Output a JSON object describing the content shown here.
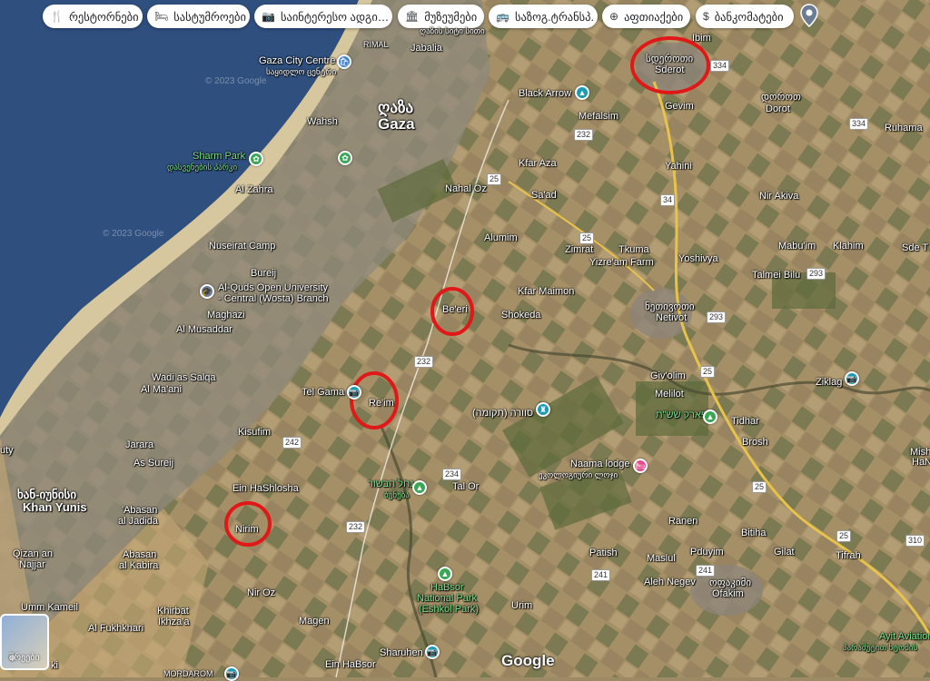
{
  "chips": [
    {
      "label": "რესტორნები",
      "icon": "fork-knife-icon",
      "glyph": "🍴"
    },
    {
      "label": "სასტუმროები",
      "icon": "bed-icon",
      "glyph": "🛏"
    },
    {
      "label": "საინტერესო ადგი…",
      "icon": "camera-icon",
      "glyph": "📷"
    },
    {
      "label": "მუზეუმები",
      "icon": "museum-icon",
      "glyph": "🏛"
    },
    {
      "label": "საზოგ.ტრანსპ.",
      "icon": "bus-icon",
      "glyph": "🚌"
    },
    {
      "label": "აფთიაქები",
      "icon": "pharmacy-icon",
      "glyph": "⊕"
    },
    {
      "label": "ბანკომატები",
      "icon": "atm-icon",
      "glyph": "$"
    }
  ],
  "labels": {
    "gaza_geo": "ღაზა",
    "gaza": "Gaza",
    "rimal": "RIMAL",
    "jabalia": "Jabalia",
    "gaza_city_centre": "Gaza City Centre",
    "gaza_city_centre_geo": "საყიდლო ცენტრი",
    "wahsh": "Wahsh",
    "sharm_park": "Sharm Park",
    "sharm_park_geo": "დასვენების პარკი",
    "al_zahra": "Al Zahra",
    "nuseirat": "Nuseirat Camp",
    "bureij": "Bureij",
    "alquds1": "Al-Quds Open University",
    "alquds2": "- Central (Wosta) Branch",
    "maghazi": "Maghazi",
    "al_musaddar": "Al Musaddar",
    "wadi": "Wadi as Salqa",
    "al_maani": "Al Ma'ani",
    "kisufim": "Kisufim",
    "jarara": "Jarara",
    "as_sureij": "As Sureij",
    "khan_yunis_geo": "ხან-იუნისი",
    "khan_yunis": "Khan Yunis",
    "abasan_jadida1": "'Abasan",
    "abasan_jadida2": "al Jadida",
    "qizan1": "Qizan an",
    "qizan2": "Najjar",
    "abasan_kabira1": "Abasan",
    "abasan_kabira2": "al Kabira",
    "umm_kameil": "Umm Kameil",
    "khirbat1": "Khirbat",
    "khirbat2": "Ikhza'a",
    "al_fukhkhari": "Al Fukhkhari",
    "mordarom": "MORDAROM",
    "ein_hashlosha": "Ein HaShlosha",
    "nirim": "Nirim",
    "nir_oz": "Nir Oz",
    "magen": "Magen",
    "sharuhen": "Sharuhen",
    "ein_habsor": "Ein HaBsor",
    "tel_gama": "Tel Gama",
    "reim": "Re'im",
    "beeri": "Be'eri",
    "shokeda": "Shokeda",
    "kfar_maimon": "Kfar Maimon",
    "alumim": "Alumim",
    "nahal_oz": "Nahal Oz",
    "kfar_aza": "Kfar Aza",
    "saad": "Sa'ad",
    "black_arrow": "Black Arrow",
    "mefalsim": "Mefalsim",
    "ibim": "Ibim",
    "sderot_geo": "სდეროთი",
    "sderot": "Sderot",
    "gevim": "Gevim",
    "dorot_geo": "დოროთ",
    "dorot": "Dorot",
    "ruhama": "Ruhama",
    "yahini": "Yahini",
    "nir_akiva": "Nir Akiva",
    "zimrat": "Zimrat",
    "tkuma": "Tkuma",
    "yizre_am": "Yizre'am Farm",
    "yoshivya": "Yoshivya",
    "mabuim": "Mabu'im",
    "klahim": "Klahim",
    "sde_t": "Sde T",
    "talmei_bilu": "Talmei Bilu",
    "netivot_geo": "ნეთივოთი",
    "netivot": "Netivot",
    "givolim": "Giv'olim",
    "melilot": "Melilot",
    "ziklag": "Ziklag",
    "park_sheshet": "פארק שש\"ת",
    "tidhar": "Tidhar",
    "brosh": "Brosh",
    "mish": "Mish",
    "ha_n": "HaN",
    "tkuma_hebrew": "סוורה (תקומה)",
    "naama": "Naama lodge",
    "naama_geo": "ეკოლოგიური ლოჯი",
    "nahal_habsor_heb": "נחל הבשור",
    "nahal_habsor_geo": "ბუნება",
    "tal_or": "Tal Or",
    "ranen": "Ranen",
    "bitiha": "Bitiha",
    "gilat": "Gilat",
    "tifrah": "Tifrah",
    "patish": "Patish",
    "maslul": "Maslul",
    "pduyim": "Pduyim",
    "aleh_negev": "Aleh Negev",
    "ofakim_geo": "ოფაკიმი",
    "ofakim": "Ofakim",
    "habsor_park1": "HaBsor",
    "habsor_park2": "National Park",
    "habsor_park3": "(Eshkol Park)",
    "urim": "Urim",
    "ayit1": "Ayit Aviation",
    "ayit2": "პარაშუტით ხტომის",
    "gaza_top_geo": "ღაზის სიტი სითი",
    "uty": "uty",
    "ki": "ki",
    "watermark": "© 2023 Google"
  },
  "roads": [
    "334",
    "232",
    "25",
    "34",
    "25",
    "293",
    "25",
    "232",
    "242",
    "234",
    "232",
    "241",
    "25",
    "310",
    "241",
    "334",
    "293",
    "25"
  ],
  "layers_label": "შრეები",
  "google_logo": "Google",
  "colors": {
    "sea": "#2f4f7e",
    "land": "#9c8a64",
    "circle": "#e01818"
  }
}
